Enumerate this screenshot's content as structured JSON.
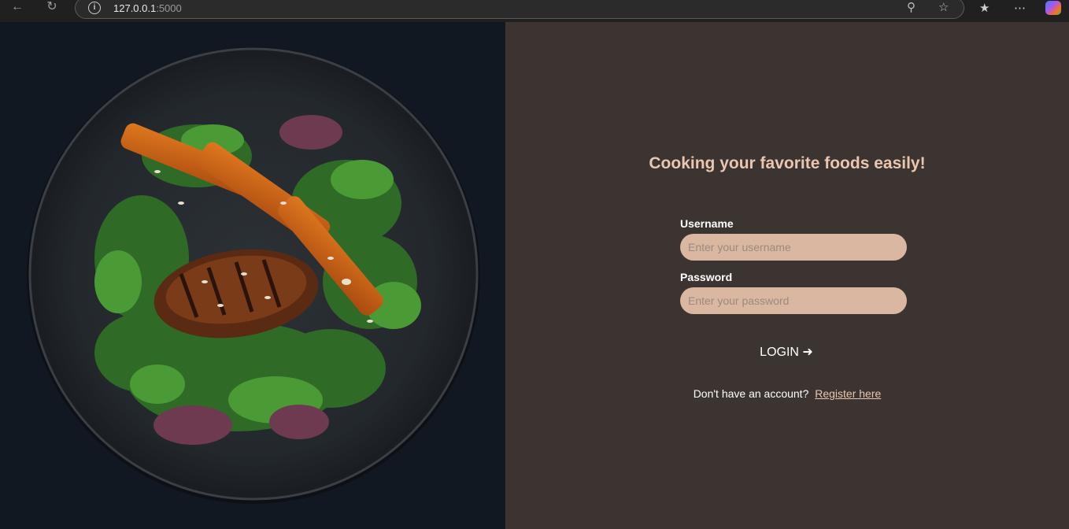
{
  "browser": {
    "url_host": "127.0.0.1",
    "url_port": ":5000",
    "icons": [
      "back-icon",
      "refresh-icon",
      "info-icon",
      "zoom-icon",
      "star-icon",
      "favorites-icon",
      "more-icon",
      "copilot-icon"
    ]
  },
  "hero": {
    "image_subject": "grilled chicken and roasted squash salad on dark plate"
  },
  "login": {
    "headline": "Cooking your favorite foods easily!",
    "username_label": "Username",
    "username_placeholder": "Enter your username",
    "password_label": "Password",
    "password_placeholder": "Enter your password",
    "login_button": "LOGIN ➜",
    "register_prompt": "Don't have an account?",
    "register_link": "Register here"
  },
  "colors": {
    "panel_bg": "#3c3430",
    "accent": "#e9c6b0",
    "input_bg": "#d9b7a0"
  }
}
